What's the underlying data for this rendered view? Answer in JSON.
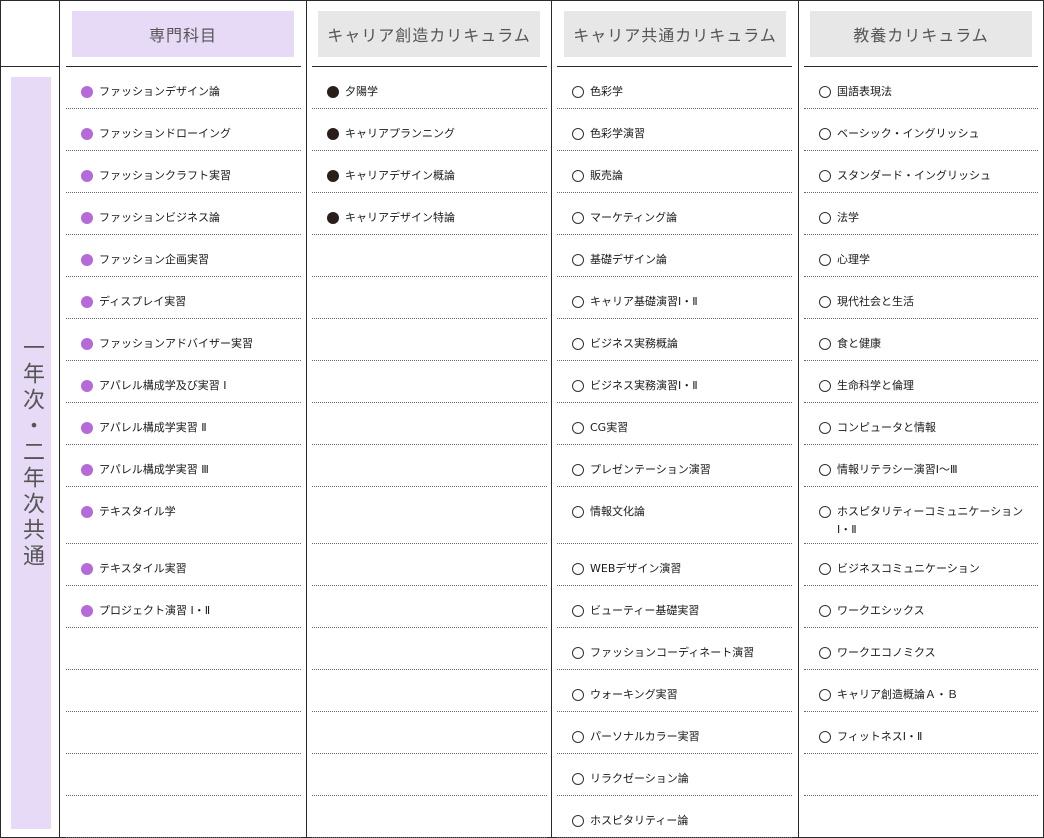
{
  "headers": {
    "specialty": "専門科目",
    "career_creation": "キャリア創造カリキュラム",
    "career_common": "キャリア共通カリキュラム",
    "liberal_arts": "教養カリキュラム"
  },
  "sidebar_label": "一年次・二年次共通",
  "colors": {
    "specialty_marker": "#b46ad8",
    "career_creation_marker": "#2a1e1a",
    "header_highlight": "#e6daf6",
    "header_grey": "#e7e7e7"
  },
  "specialty": [
    "ファッションデザイン論",
    "ファッションドローイング",
    "ファッションクラフト実習",
    "ファッションビジネス論",
    "ファッション企画実習",
    "ディスプレイ実習",
    "ファッションアドバイザー実習",
    "アパレル構成学及び実習 Ⅰ",
    "アパレル構成学実習 Ⅱ",
    "アパレル構成学実習 Ⅲ",
    "テキスタイル学",
    "テキスタイル実習",
    "プロジェクト演習 Ⅰ・Ⅱ"
  ],
  "career_creation": [
    "夕陽学",
    "キャリアプランニング",
    "キャリアデザイン概論",
    "キャリアデザイン特論"
  ],
  "career_common": [
    "色彩学",
    "色彩学演習",
    "販売論",
    "マーケティング論",
    "基礎デザイン論",
    "キャリア基礎演習Ⅰ・Ⅱ",
    "ビジネス実務概論",
    "ビジネス実務演習Ⅰ・Ⅱ",
    "CG実習",
    "プレゼンテーション演習",
    "情報文化論",
    "WEBデザイン演習",
    "ビューティー基礎実習",
    "ファッションコーディネート演習",
    "ウォーキング実習",
    "パーソナルカラー実習",
    "リラクゼーション論",
    "ホスピタリティー論"
  ],
  "liberal_arts": [
    "国語表現法",
    "ベーシック・イングリッシュ",
    "スタンダード・イングリッシュ",
    "法学",
    "心理学",
    "現代社会と生活",
    "食と健康",
    "生命科学と倫理",
    "コンピュータと情報",
    "情報リテラシー演習Ⅰ～Ⅲ",
    "ホスピタリティーコミュニケーションⅠ・Ⅱ",
    "ビジネスコミュニケーション",
    "ワークエシックス",
    "ワークエコノミクス",
    "キャリア創造概論Ａ・Ｂ",
    "フィットネスⅠ・Ⅱ"
  ]
}
